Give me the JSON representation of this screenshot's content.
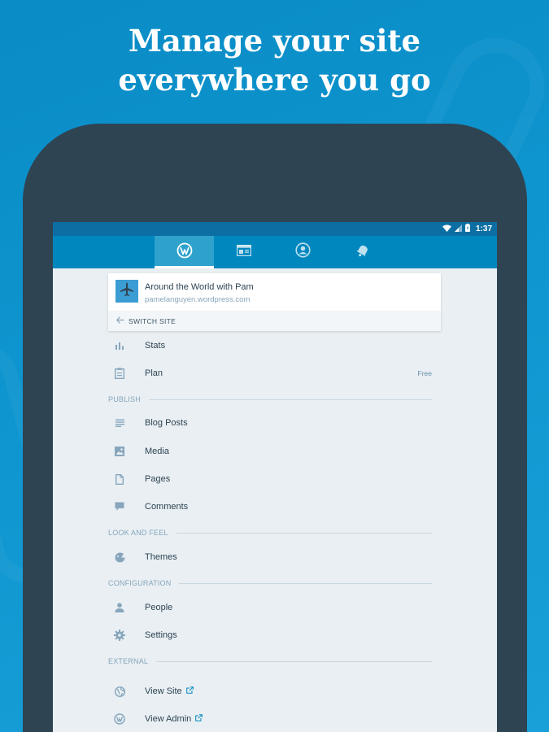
{
  "headline": {
    "line1": "Manage your site",
    "line2": "everywhere you go"
  },
  "status_bar": {
    "time": "1:37"
  },
  "tabs": [
    {
      "name": "my-sites",
      "icon": "wordpress-icon",
      "active": true
    },
    {
      "name": "reader",
      "icon": "reader-icon",
      "active": false
    },
    {
      "name": "me",
      "icon": "profile-icon",
      "active": false
    },
    {
      "name": "notifications",
      "icon": "bell-icon",
      "active": false
    }
  ],
  "site": {
    "title": "Around the World with Pam",
    "url": "pamelanguyen.wordpress.com",
    "switch_label": "SWITCH SITE"
  },
  "menu": {
    "stats": "Stats",
    "plan": "Plan",
    "plan_value": "Free",
    "publish_header": "PUBLISH",
    "blog_posts": "Blog Posts",
    "media": "Media",
    "pages": "Pages",
    "comments": "Comments",
    "look_header": "LOOK AND FEEL",
    "themes": "Themes",
    "config_header": "CONFIGURATION",
    "people": "People",
    "settings": "Settings",
    "external_header": "EXTERNAL",
    "view_site": "View Site",
    "view_admin": "View Admin"
  },
  "colors": {
    "background": "#0f96d0",
    "device": "#2f4453",
    "app_bar": "#0087be",
    "status_bar": "#0d6ea4",
    "menu_bg": "#e9eff3",
    "icon": "#87a6bc"
  }
}
